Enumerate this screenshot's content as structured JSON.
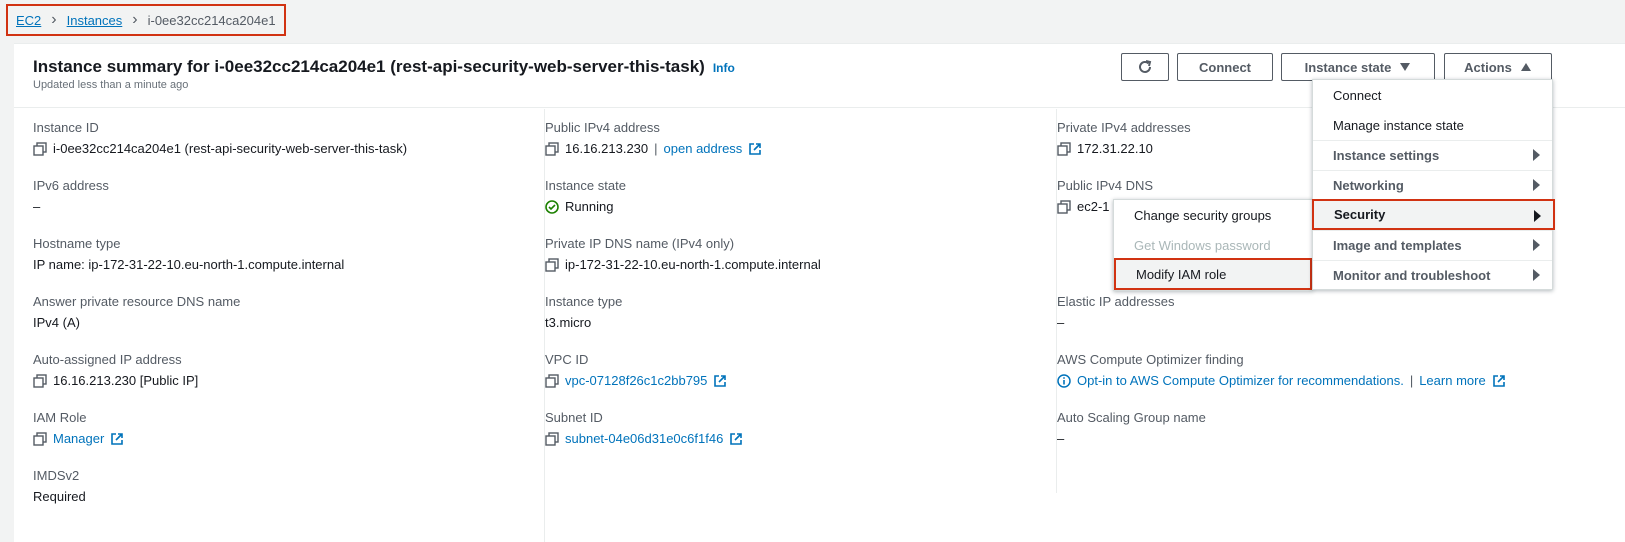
{
  "breadcrumb": {
    "items": [
      "EC2",
      "Instances"
    ],
    "current": "i-0ee32cc214ca204e1"
  },
  "header": {
    "title": "Instance summary for i-0ee32cc214ca204e1 (rest-api-security-web-server-this-task)",
    "info": "Info",
    "subtitle": "Updated less than a minute ago",
    "connect": "Connect",
    "instance_state": "Instance state",
    "actions": "Actions"
  },
  "col1": {
    "instance_id_label": "Instance ID",
    "instance_id_value": "i-0ee32cc214ca204e1 (rest-api-security-web-server-this-task)",
    "ipv6_label": "IPv6 address",
    "ipv6_value": "–",
    "hostname_label": "Hostname type",
    "hostname_value": "IP name: ip-172-31-22-10.eu-north-1.compute.internal",
    "dns_name_label": "Answer private resource DNS name",
    "dns_name_value": "IPv4 (A)",
    "auto_ip_label": "Auto-assigned IP address",
    "auto_ip_value": "16.16.213.230 [Public IP]",
    "iam_label": "IAM Role",
    "iam_value": "Manager",
    "imds_label": "IMDSv2",
    "imds_value": "Required"
  },
  "col2": {
    "public_ipv4_label": "Public IPv4 address",
    "public_ipv4_value": "16.16.213.230",
    "open_address": "open address",
    "state_label": "Instance state",
    "state_value": "Running",
    "private_dns_label": "Private IP DNS name (IPv4 only)",
    "private_dns_value": "ip-172-31-22-10.eu-north-1.compute.internal",
    "type_label": "Instance type",
    "type_value": "t3.micro",
    "vpc_label": "VPC ID",
    "vpc_value": "vpc-07128f26c1c2bb795",
    "subnet_label": "Subnet ID",
    "subnet_value": "subnet-04e06d31e0c6f1f46"
  },
  "col3": {
    "private_ipv4_label": "Private IPv4 addresses",
    "private_ipv4_value": "172.31.22.10",
    "public_dns_label": "Public IPv4 DNS",
    "public_dns_value": "ec2-1",
    "elastic_label": "Elastic IP addresses",
    "elastic_value": "–",
    "optimizer_label": "AWS Compute Optimizer finding",
    "optimizer_value": "Opt-in to AWS Compute Optimizer for recommendations.",
    "learn_more": "Learn more",
    "asg_label": "Auto Scaling Group name",
    "asg_value": "–"
  },
  "actions_menu": {
    "connect": "Connect",
    "manage_state": "Manage instance state",
    "instance_settings": "Instance settings",
    "networking": "Networking",
    "security": "Security",
    "image_templates": "Image and templates",
    "monitor": "Monitor and troubleshoot"
  },
  "security_submenu": {
    "change_sg": "Change security groups",
    "get_password": "Get Windows password",
    "modify_iam": "Modify IAM role"
  },
  "colors": {
    "link": "#0073bb",
    "highlight_border": "#d13212",
    "running": "#1d8102"
  }
}
